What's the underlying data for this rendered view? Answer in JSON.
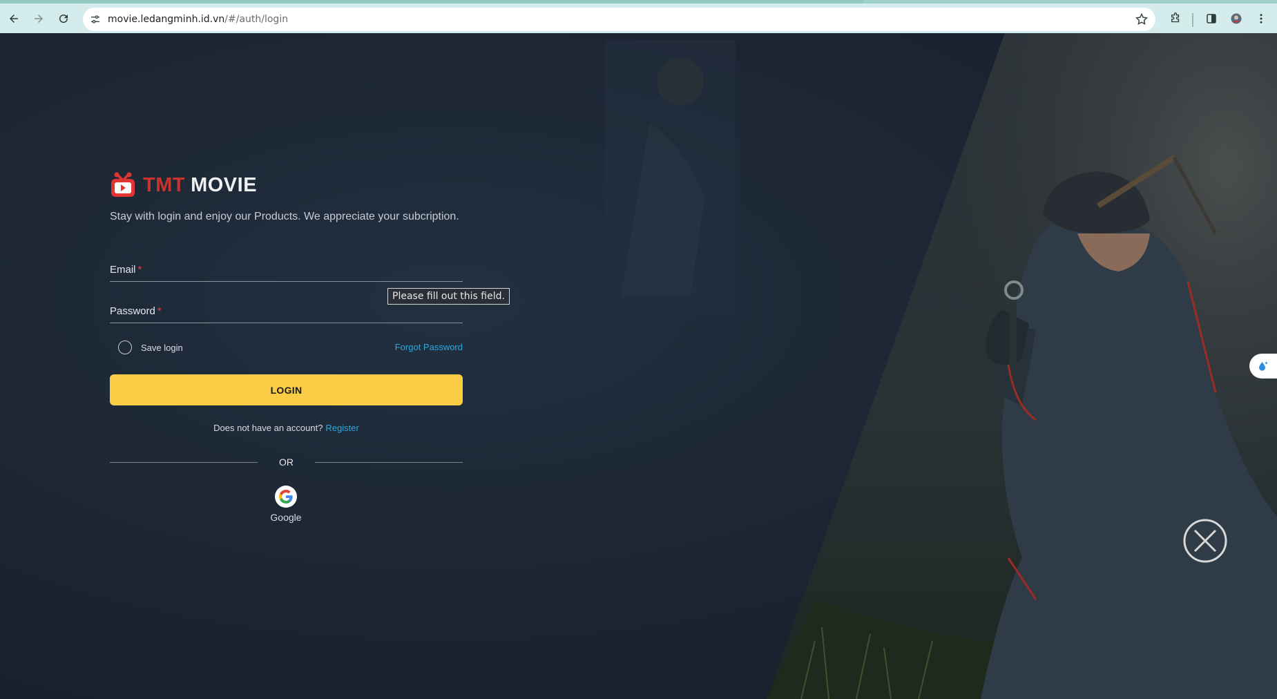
{
  "browser": {
    "url_host": "movie.ledangminh.id.vn",
    "url_path": "/#/auth/login",
    "icons": [
      "back-icon",
      "forward-icon",
      "reload-icon",
      "site-info-icon",
      "bookmark-star-icon",
      "extensions-icon",
      "side-panel-icon",
      "profile-avatar",
      "menu-icon"
    ]
  },
  "brand": {
    "word1": "TMT",
    "word2": "MOVIE",
    "tagline": "Stay with login and enjoy our Products. We appreciate your subcription."
  },
  "form": {
    "email_label": "Email",
    "password_label": "Password",
    "required_mark": "*",
    "validation_tooltip": "Please fill out this field.",
    "save_login_label": "Save login",
    "forgot_password": "Forgot Password",
    "login_button": "LOGIN",
    "no_account_text": "Does not have an account?",
    "register_link": "Register",
    "or_text": "OR",
    "google_label": "Google"
  },
  "colors": {
    "brand_red": "#c7332e",
    "login_yellow": "#fbcd47",
    "link_blue": "#2aa9e0",
    "background": "#1b2330"
  }
}
